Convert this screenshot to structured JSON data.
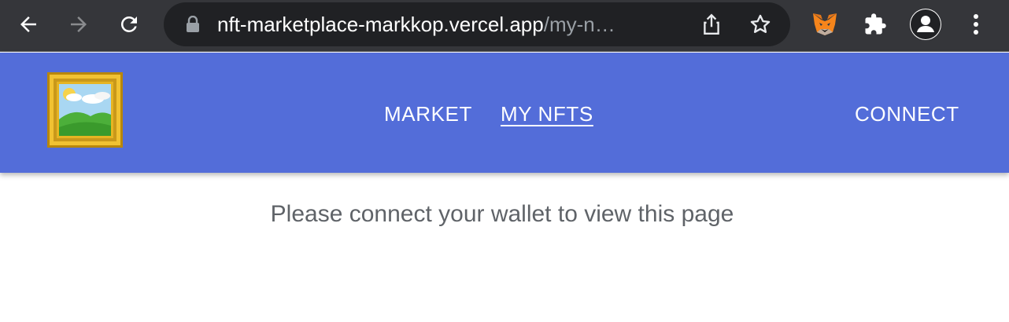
{
  "browser": {
    "url_host": "nft-marketplace-markkop.vercel.app",
    "url_path": "/my-n…"
  },
  "header": {
    "nav": [
      {
        "label": "MARKET",
        "active": false
      },
      {
        "label": "MY NFTS",
        "active": true
      }
    ],
    "connect_label": "CONNECT",
    "colors": {
      "background": "#536dd9",
      "text": "#ffffff"
    }
  },
  "main": {
    "message": "Please connect your wallet to view this page"
  },
  "icons": [
    "back-arrow-icon",
    "forward-arrow-icon",
    "reload-icon",
    "lock-icon",
    "share-icon",
    "star-icon",
    "metamask-fox-icon",
    "puzzle-extensions-icon",
    "profile-avatar-icon",
    "kebab-menu-icon",
    "framed-picture-icon"
  ]
}
